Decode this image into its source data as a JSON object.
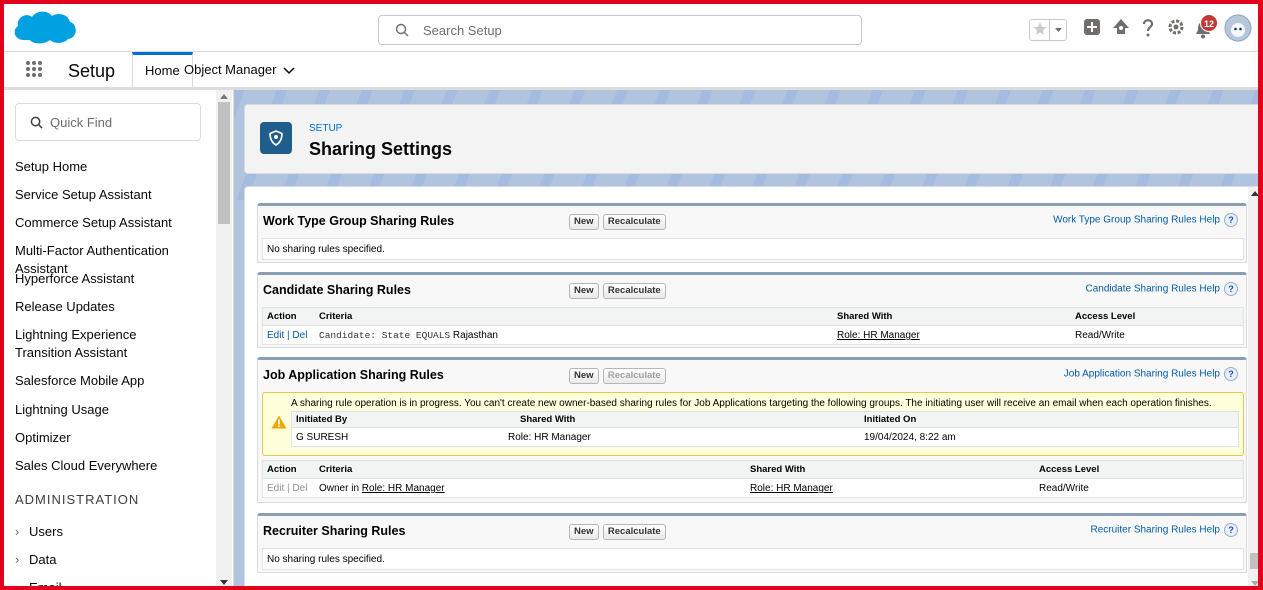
{
  "header": {
    "search_placeholder": "Search Setup",
    "notification_count": "12",
    "icons": [
      "favorites-star-icon",
      "add-icon",
      "trailhead-icon",
      "help-icon",
      "gear-icon",
      "bell-icon",
      "avatar"
    ],
    "brand_color": "#00a1e0"
  },
  "nav": {
    "app_name": "Setup",
    "tabs": [
      {
        "label": "Home"
      },
      {
        "label": "Object Manager"
      }
    ]
  },
  "sidebar": {
    "quick_find_placeholder": "Quick Find",
    "items": [
      "Setup Home",
      "Service Setup Assistant",
      "Commerce Setup Assistant",
      "Multi-Factor Authentication Assistant",
      "Hyperforce Assistant",
      "Release Updates",
      "Lightning Experience Transition Assistant",
      "Salesforce Mobile App",
      "Lightning Usage",
      "Optimizer",
      "Sales Cloud Everywhere"
    ],
    "section_heading": "ADMINISTRATION",
    "expandables": [
      "Users",
      "Data",
      "Email"
    ]
  },
  "page": {
    "pre_title": "SETUP",
    "title": "Sharing Settings"
  },
  "buttons": {
    "new": "New",
    "recalculate": "Recalculate"
  },
  "sections": {
    "work_type": {
      "title": "Work Type Group Sharing Rules",
      "help": "Work Type Group Sharing Rules Help",
      "empty": "No sharing rules specified."
    },
    "candidate": {
      "title": "Candidate Sharing Rules",
      "help": "Candidate Sharing Rules Help",
      "columns": [
        "Action",
        "Criteria",
        "Shared With",
        "Access Level"
      ],
      "row": {
        "edit": "Edit",
        "sep": "|",
        "del": "Del",
        "criteria_code": "Candidate: State EQUALS",
        "criteria_value": "Rajasthan",
        "shared_with": "Role: HR Manager",
        "access": "Read/Write"
      }
    },
    "job_application": {
      "title": "Job Application Sharing Rules",
      "help": "Job Application Sharing Rules Help",
      "warning": "A sharing rule operation is in progress. You can't create new owner-based sharing rules for Job Applications targeting the following groups. The initiating user will receive an email when each operation finishes.",
      "warning_columns": [
        "Initiated By",
        "Shared With",
        "Initiated On"
      ],
      "warning_row": {
        "initiated_by": "G SURESH",
        "shared_with": "Role: HR Manager",
        "initiated_on": "19/04/2024, 8:22 am"
      },
      "columns": [
        "Action",
        "Criteria",
        "Shared With",
        "Access Level"
      ],
      "row": {
        "edit": "Edit",
        "sep": "|",
        "del": "Del",
        "criteria_prefix": "Owner in",
        "criteria_link": "Role: HR Manager",
        "shared_with": "Role: HR Manager",
        "access": "Read/Write"
      }
    },
    "recruiter": {
      "title": "Recruiter Sharing Rules",
      "help": "Recruiter Sharing Rules Help",
      "empty": "No sharing rules specified."
    }
  }
}
